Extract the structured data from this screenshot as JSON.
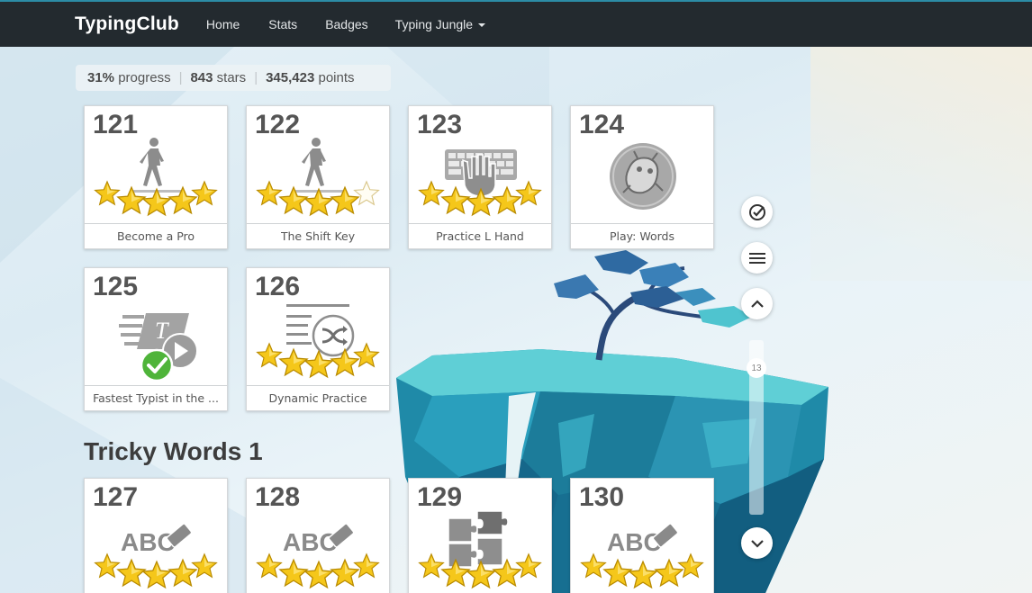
{
  "nav": {
    "brand": "TypingClub",
    "links": [
      "Home",
      "Stats",
      "Badges",
      "Typing Jungle"
    ]
  },
  "progress": {
    "percent": "31%",
    "percent_label": "progress",
    "stars": "843",
    "stars_label": "stars",
    "points": "345,423",
    "points_label": "points"
  },
  "lessons": [
    {
      "number": "121",
      "title": "Become a Pro",
      "stars": 5,
      "icon": "walking-person-icon"
    },
    {
      "number": "122",
      "title": "The Shift Key",
      "stars": 4,
      "icon": "walking-person-icon"
    },
    {
      "number": "123",
      "title": "Practice L Hand",
      "stars": 5,
      "icon": "keyboard-hand-icon"
    },
    {
      "number": "124",
      "title": "Play: Words",
      "stars": 0,
      "icon": "game-creature-icon"
    },
    {
      "number": "125",
      "title": "Fastest Typist in the ...",
      "stars": 0,
      "icon": "speed-video-icon",
      "completed": true
    },
    {
      "number": "126",
      "title": "Dynamic Practice",
      "stars": 5,
      "icon": "shuffle-list-icon"
    }
  ],
  "section": {
    "title": "Tricky Words 1",
    "lessons": [
      {
        "number": "127",
        "stars": 5,
        "icon": "abc-eraser-icon",
        "icon_text": "ABC"
      },
      {
        "number": "128",
        "stars": 5,
        "icon": "abc-eraser-icon",
        "icon_text": "ABC"
      },
      {
        "number": "129",
        "stars": 5,
        "icon": "puzzle-icon"
      },
      {
        "number": "130",
        "stars": 5,
        "icon": "abc-eraser-icon",
        "icon_text": "ABC"
      }
    ]
  },
  "controls": {
    "scroll_position": "13",
    "icons": [
      "check-circle-icon",
      "menu-icon",
      "chevron-up-icon",
      "chevron-down-icon"
    ]
  },
  "colors": {
    "nav_bg": "#232a2f",
    "star": "#f5c71a",
    "card_text": "#555555"
  }
}
